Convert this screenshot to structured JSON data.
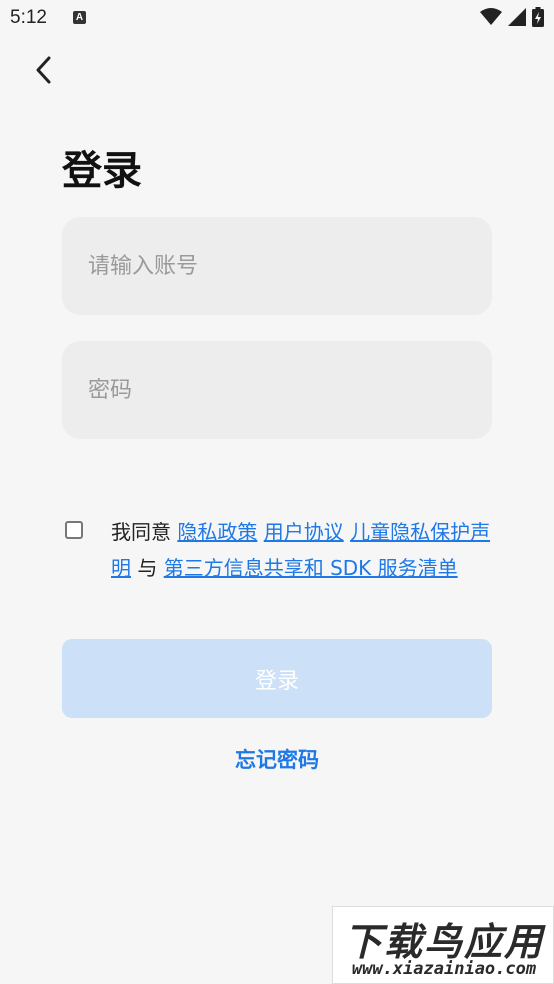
{
  "status_bar": {
    "time": "5:12",
    "notification_icon": "A"
  },
  "header": {
    "back_icon": "chevron-left-icon",
    "title": "登录"
  },
  "form": {
    "account_placeholder": "请输入账号",
    "password_placeholder": "密码",
    "checkbox_checked": false
  },
  "agreement": {
    "prefix": "我同意 ",
    "links": [
      "隐私政策",
      "用户协议",
      "儿童隐私保护声明",
      "第三方信息共享和 SDK 服务清单"
    ],
    "connector": " 与 "
  },
  "actions": {
    "login_label": "登录",
    "forgot_label": "忘记密码"
  },
  "watermark": {
    "title": "下载鸟应用",
    "url": "www.xiazainiao.com"
  },
  "colors": {
    "accent": "#1e78e6",
    "login_disabled_bg": "#cce0f7",
    "input_bg": "#ededed",
    "page_bg": "#f6f6f6"
  }
}
